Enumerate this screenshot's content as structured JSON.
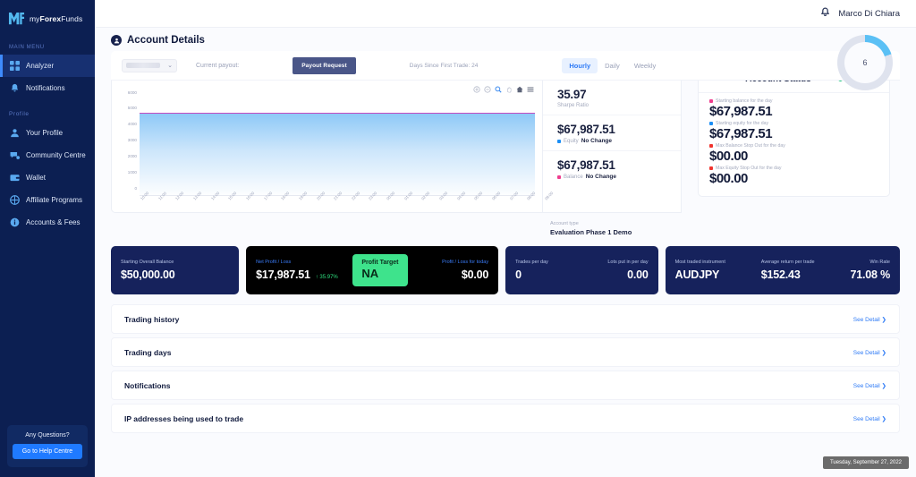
{
  "brand": {
    "mark": "MF",
    "prefix": "my",
    "bold": "Forex",
    "suffix": "Funds"
  },
  "sidebar": {
    "main_menu_label": "MAIN MENU",
    "profile_label": "Profile",
    "main_items": [
      {
        "label": "Analyzer",
        "icon": "grid-icon"
      },
      {
        "label": "Notifications",
        "icon": "bell-icon"
      }
    ],
    "profile_items": [
      {
        "label": "Your Profile",
        "icon": "user-icon"
      },
      {
        "label": "Community Centre",
        "icon": "chat-icon"
      },
      {
        "label": "Wallet",
        "icon": "wallet-icon"
      },
      {
        "label": "Affiliate Programs",
        "icon": "affiliate-icon"
      },
      {
        "label": "Accounts & Fees",
        "icon": "info-icon"
      }
    ],
    "help": {
      "question": "Any Questions?",
      "button": "Go to Help Centre"
    }
  },
  "topbar": {
    "username": "Marco Di Chiara"
  },
  "header": {
    "title": "Account Details"
  },
  "toolbar": {
    "account_select_value": "",
    "current_payout_label": "Current payout:",
    "payout_button": "Payout Request",
    "days_since_first_trade": "Days Since First Trade: 24",
    "segments": [
      {
        "label": "Hourly",
        "active": true
      },
      {
        "label": "Daily",
        "active": false
      },
      {
        "label": "Weekly",
        "active": false
      }
    ],
    "gauge_value": "6",
    "gauge_percent": 20
  },
  "chart_data": {
    "type": "area",
    "title": "",
    "xlabel": "",
    "ylabel": "",
    "ylim": [
      0,
      6000
    ],
    "yticks": [
      6000,
      5000,
      4000,
      3000,
      2000,
      1000,
      0
    ],
    "grid": false,
    "x": [
      "10:00",
      "11:00",
      "12:00",
      "13:00",
      "14:00",
      "15:00",
      "16:00",
      "17:00",
      "18:00",
      "19:00",
      "20:00",
      "21:00",
      "22:00",
      "23:00",
      "00:00",
      "01:00",
      "02:00",
      "03:00",
      "04:00",
      "05:00",
      "06:00",
      "07:00",
      "08:00",
      "09:00"
    ],
    "series": [
      {
        "name": "Balance",
        "color": "#c44bbf",
        "values": [
          5050,
          5050,
          5050,
          5050,
          5050,
          5050,
          5050,
          5050,
          5050,
          5050,
          5050,
          5050,
          5050,
          5050,
          5050,
          5050,
          5050,
          5050,
          5050,
          5050,
          5050,
          5050,
          5050,
          5050
        ]
      }
    ],
    "toolbar_icons": [
      "zoom-in-icon",
      "zoom-out-icon",
      "selection-zoom-icon",
      "pan-icon",
      "home-icon",
      "menu-icon"
    ]
  },
  "stats_panel": {
    "cells": [
      {
        "value": "35.97",
        "label": "Sharpe Ratio",
        "dot": "",
        "change": ""
      },
      {
        "value": "$67,987.51",
        "label": "Equity",
        "dot": "#1b8ef5",
        "change": "No Change"
      },
      {
        "value": "$67,987.51",
        "label": "Balance",
        "dot": "#ee3d8e",
        "change": "No Change"
      }
    ],
    "account_type_label": "Account type",
    "account_type_value": "Evaluation Phase 1 Demo"
  },
  "account_status": {
    "title": "Account Status",
    "state": "Active",
    "rows": [
      {
        "label": "Starting balance for the day",
        "value": "$67,987.51",
        "dot": "#ee3d8e"
      },
      {
        "label": "Starting equity for the day",
        "value": "$67,987.51",
        "dot": "#1b8ef5"
      },
      {
        "label": "Max Balance Stop Out for the day",
        "value": "$00.00",
        "dot": "#f0342e"
      },
      {
        "label": "Max Equity Stop Out for the day",
        "value": "$00.00",
        "dot": "#f0342e"
      }
    ]
  },
  "kpis": {
    "starting_overall_balance_label": "Starting Overall Balance",
    "starting_overall_balance_value": "$50,000.00",
    "net_profit_loss_label": "Net Profit / Loss",
    "net_profit_loss_value": "$17,987.51",
    "net_profit_loss_delta": "↑ 35.97%",
    "profit_target_label": "Profit Target",
    "profit_target_value": "NA",
    "profit_today_label": "Profit / Loss for today",
    "profit_today_value": "$0.00",
    "trades_per_day_label": "Trades per day",
    "trades_per_day_value": "0",
    "lots_per_day_label": "Lots put in per day",
    "lots_per_day_value": "0.00",
    "most_traded_label": "Most traded instrument",
    "most_traded_value": "AUDJPY",
    "avg_return_label": "Average return per trade",
    "avg_return_value": "$152.43",
    "win_rate_label": "Win Rate",
    "win_rate_value": "71.08 %"
  },
  "lists": [
    {
      "title": "Trading history",
      "action": "See Detail ❯"
    },
    {
      "title": "Trading days",
      "action": "See Detail ❯"
    },
    {
      "title": "Notifications",
      "action": "See Detail ❯"
    },
    {
      "title": "IP addresses being used to trade",
      "action": "See Detail ❯"
    }
  ],
  "toast": {
    "text": "Tuesday, September 27, 2022"
  },
  "colors": {
    "accent": "#2f7bf6",
    "navy": "#16225c",
    "green": "#3ee38c",
    "pink": "#c44bbf"
  }
}
